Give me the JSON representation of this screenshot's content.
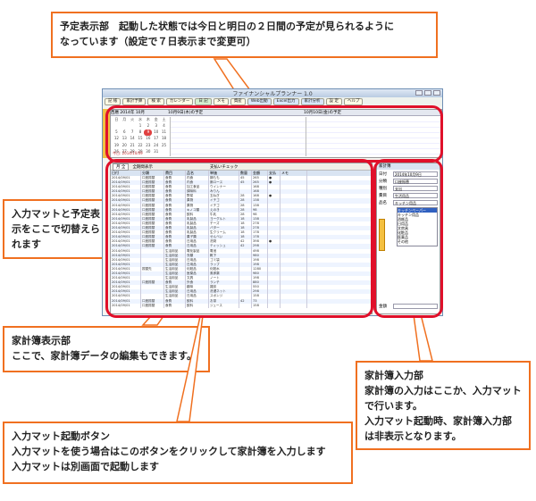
{
  "window": {
    "title": "ファイナンシャルプランナー 1.0",
    "toolbar": [
      "記 帳",
      "家計予算",
      "検 索",
      "カレンダー",
      "日 記",
      "メモ",
      "資産",
      "Web出動",
      "Excel出力",
      "家計分析",
      "設 定",
      "ヘルプ"
    ]
  },
  "schedule": {
    "month_label": "西暦 2014年 10月",
    "today_label": "10月9日(木)の予定",
    "tomorrow_label": "10月10日(金)の予定",
    "calendar_head": [
      "日",
      "月",
      "火",
      "水",
      "木",
      "金",
      "土"
    ],
    "calendar_days": [
      "",
      "",
      "",
      "1",
      "2",
      "3",
      "4",
      "5",
      "6",
      "7",
      "8",
      "9",
      "10",
      "11",
      "12",
      "13",
      "14",
      "15",
      "16",
      "17",
      "18",
      "19",
      "20",
      "21",
      "22",
      "23",
      "24",
      "25",
      "26",
      "27",
      "28",
      "29",
      "30",
      "31",
      "",
      ""
    ],
    "today_day": "9",
    "footer": "今日: 2014/10/09"
  },
  "ledger": {
    "filter": "月 全",
    "period": "全期間表示",
    "checkbox": "支払いチェック",
    "headers": [
      "日付",
      "分類",
      "費目",
      "品名",
      "単価",
      "数量",
      "金額",
      "支払",
      "メモ"
    ],
    "rows": [
      [
        "2014/09/01",
        "口座振替",
        "食費",
        "内食",
        "鶏もも",
        "45",
        "265",
        "●",
        ""
      ],
      [
        "2014/09/01",
        "口座振替",
        "食費",
        "内食",
        "豚ロース",
        "45",
        "265",
        "●",
        ""
      ],
      [
        "2014/09/01",
        "口座振替",
        "食費",
        "加工食品",
        "ウインナー",
        "",
        "168",
        "",
        ""
      ],
      [
        "2014/09/01",
        "口座振替",
        "食費",
        "調味料",
        "みりん",
        "",
        "168",
        "",
        ""
      ],
      [
        "2014/09/01",
        "口座振替",
        "食費",
        "野菜",
        "玉ねぎ",
        "28",
        "168",
        "●",
        ""
      ],
      [
        "2014/09/01",
        "口座振替",
        "食費",
        "果物",
        "イチゴ",
        "28",
        "138",
        "",
        ""
      ],
      [
        "2014/09/01",
        "口座振替",
        "食費",
        "果物",
        "イチゴ",
        "28",
        "138",
        "",
        ""
      ],
      [
        "2014/09/01",
        "口座振替",
        "食費",
        "キノコ類",
        "えのき",
        "28",
        "98",
        "",
        ""
      ],
      [
        "2014/09/01",
        "口座振替",
        "食費",
        "飲料",
        "牛乳",
        "28",
        "98",
        "",
        ""
      ],
      [
        "2014/09/01",
        "口座振替",
        "食費",
        "乳製品",
        "ヨーグルト",
        "18",
        "138",
        "",
        ""
      ],
      [
        "2014/09/01",
        "口座振替",
        "食費",
        "乳製品",
        "チーズ",
        "18",
        "278",
        "",
        ""
      ],
      [
        "2014/09/01",
        "口座振替",
        "食費",
        "乳製品",
        "バター",
        "18",
        "278",
        "",
        ""
      ],
      [
        "2014/09/01",
        "口座振替",
        "食費",
        "乳製品",
        "生クリーム",
        "18",
        "178",
        "",
        ""
      ],
      [
        "2014/09/01",
        "口座振替",
        "食費",
        "菓子類",
        "せんべい",
        "18",
        "178",
        "",
        ""
      ],
      [
        "2014/09/01",
        "口座振替",
        "食費",
        "日用品",
        "洗剤",
        "42",
        "398",
        "●",
        ""
      ],
      [
        "2014/09/01",
        "口座振替",
        "食費",
        "日用品",
        "ティッシュ",
        "42",
        "298",
        "",
        ""
      ],
      [
        "2014/09/01",
        "",
        "生活用品",
        "電化製品",
        "電池",
        "",
        "498",
        "",
        ""
      ],
      [
        "2014/09/01",
        "",
        "生活用品",
        "衣類",
        "靴下",
        "",
        "980",
        "",
        ""
      ],
      [
        "2014/09/01",
        "",
        "生活用品",
        "日用品",
        "ゴミ袋",
        "",
        "198",
        "",
        ""
      ],
      [
        "2014/09/01",
        "",
        "生活用品",
        "日用品",
        "ラップ",
        "",
        "198",
        "",
        ""
      ],
      [
        "2014/09/01",
        "振替先",
        "生活用品",
        "化粧品",
        "化粧水",
        "",
        "1280",
        "",
        ""
      ],
      [
        "2014/09/01",
        "",
        "生活用品",
        "医薬品",
        "風邪薬",
        "",
        "980",
        "",
        ""
      ],
      [
        "2014/09/01",
        "",
        "生活用品",
        "文具",
        "ノート",
        "",
        "198",
        "",
        ""
      ],
      [
        "2014/09/01",
        "口座振替",
        "食費",
        "外食",
        "ランチ",
        "",
        "880",
        "",
        ""
      ],
      [
        "2014/09/01",
        "",
        "生活用品",
        "趣味",
        "雑誌",
        "",
        "550",
        "",
        ""
      ],
      [
        "2014/09/01",
        "",
        "生活用品",
        "日用品",
        "洗濯ネット",
        "",
        "298",
        "",
        ""
      ],
      [
        "2014/09/01",
        "",
        "生活用品",
        "日用品",
        "スポンジ",
        "",
        "158",
        "",
        ""
      ],
      [
        "2014/09/01",
        "口座振替",
        "食費",
        "飲料",
        "お茶",
        "42",
        "73",
        "",
        ""
      ],
      [
        "2014/09/01",
        "口座振替",
        "食費",
        "飲料",
        "ジュース",
        "",
        "158",
        "",
        ""
      ]
    ]
  },
  "entry": {
    "title": "家計簿",
    "date_label": "日付",
    "date_value": "2014年10月9日",
    "category_label": "分類",
    "category_value": "口座振替",
    "kind_label": "種別",
    "kind_value": "支出",
    "item_label": "費目",
    "item_value": "生活用品",
    "name_label": "品名",
    "name_value": "キッチン用品",
    "list": [
      "キッチンペーパー",
      "キッチン用品",
      "消耗品",
      "日用品",
      "文房具",
      "化粧品",
      "医薬品",
      "その他"
    ],
    "list_selected": 0,
    "amount_label": "金額"
  },
  "callouts": {
    "schedule": "予定表示部　起動した状態では今日と明日の２日間の予定が見られるように\nなっています（設定で７日表示まで変更可）",
    "switch": "入力マットと予定表\n示をここで切替えら\nれます",
    "ledger": "家計簿表示部\nここで、家計簿データの編集もできます。",
    "mat_button": "入力マット起動ボタン\n入力マットを使う場合はこのボタンをクリックして家計簿を入力します\n入力マットは別画面で起動します",
    "entry": "家計簿入力部\n家計簿の入力はここか、入力マット\nで行います。\n入力マット起動時、家計簿入力部\nは非表示となります。"
  }
}
